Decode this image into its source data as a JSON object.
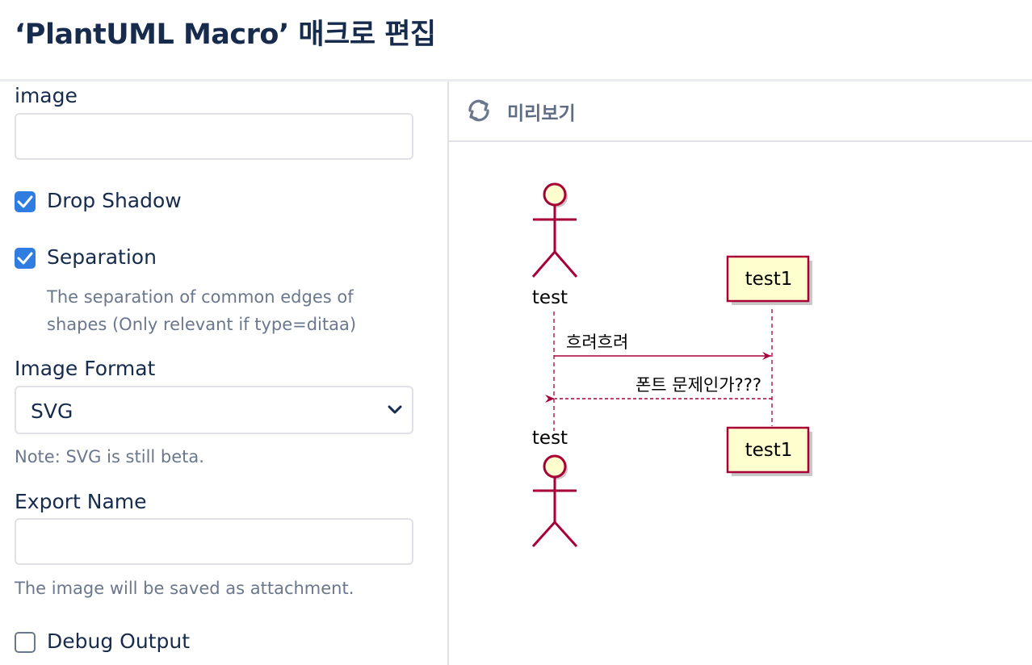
{
  "dialog": {
    "title": "‘PlantUML Macro’ 매크로 편집"
  },
  "form": {
    "image_label": "image",
    "image_value": "",
    "drop_shadow": {
      "label": "Drop Shadow",
      "checked": true
    },
    "separation": {
      "label": "Separation",
      "checked": true,
      "help_line1": "The separation of common edges of",
      "help_line2": "shapes (Only relevant if type=ditaa)"
    },
    "image_format": {
      "label": "Image Format",
      "selected": "SVG",
      "note": "Note: SVG is still beta."
    },
    "export_name": {
      "label": "Export Name",
      "value": "",
      "note": "The image will be saved as attachment."
    },
    "debug_output": {
      "label": "Debug Output",
      "checked": false
    }
  },
  "preview": {
    "title": "미리보기",
    "refresh_icon": "refresh-icon",
    "diagram": {
      "actor_name": "test",
      "participant_name": "test1",
      "message_request": "흐려흐려",
      "message_reply": "폰트 문제인가???",
      "colors": {
        "lifeline": "#a80036",
        "participant_fill": "#fefece",
        "shadow": "#c8c8c8"
      }
    }
  },
  "colors": {
    "accent": "#2f7de1",
    "title_text": "#172b4d",
    "muted_text": "#6b778c",
    "border": "#dfe1e6"
  }
}
